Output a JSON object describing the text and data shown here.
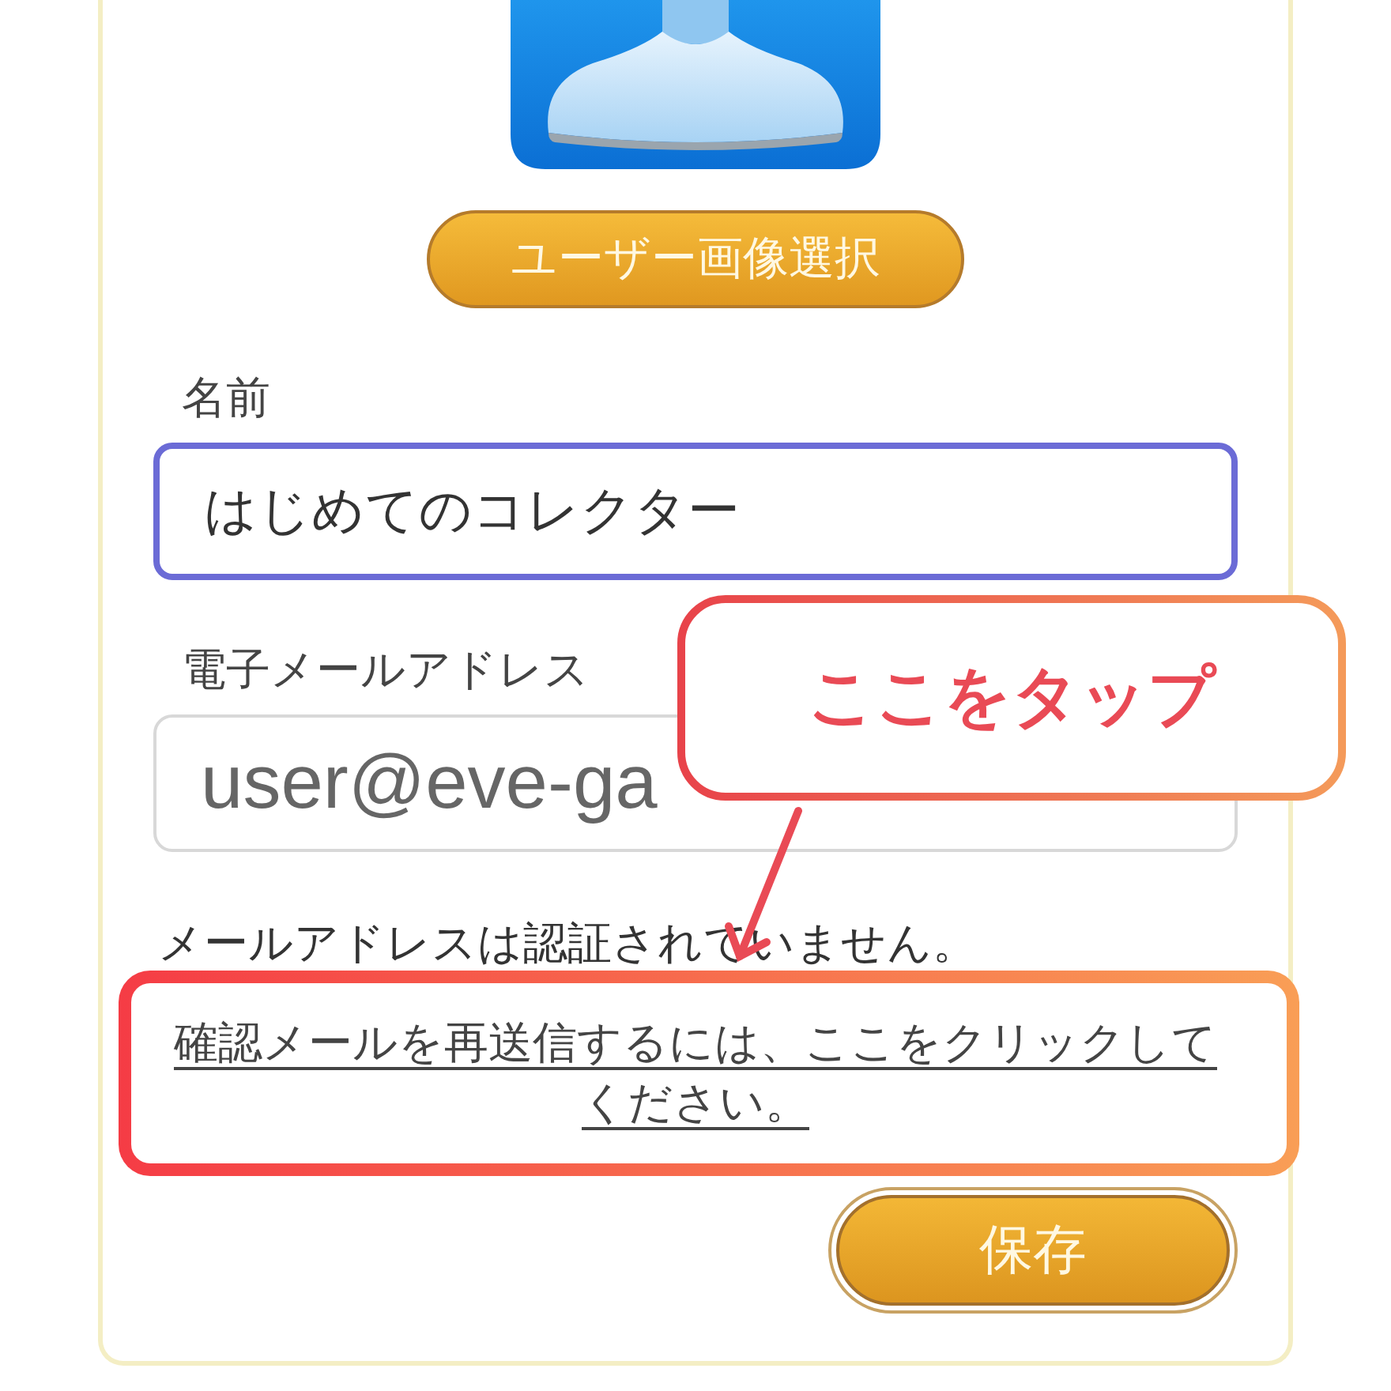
{
  "select_image_button": "ユーザー画像選択",
  "fields": [
    {
      "kind": "text",
      "label": "名前",
      "value": "はじめてのコレクター",
      "focused": true
    },
    {
      "kind": "email",
      "label": "電子メールアドレス",
      "value": "user@eve-ga",
      "focused": false
    }
  ],
  "verification_message": "メールアドレスは認証されていません。",
  "resend_link": {
    "text": "確認メールを再送信するには、ここをクリックしてください。",
    "highlighted": true
  },
  "save_button": "保存",
  "callout": {
    "text": "ここをタップ"
  }
}
